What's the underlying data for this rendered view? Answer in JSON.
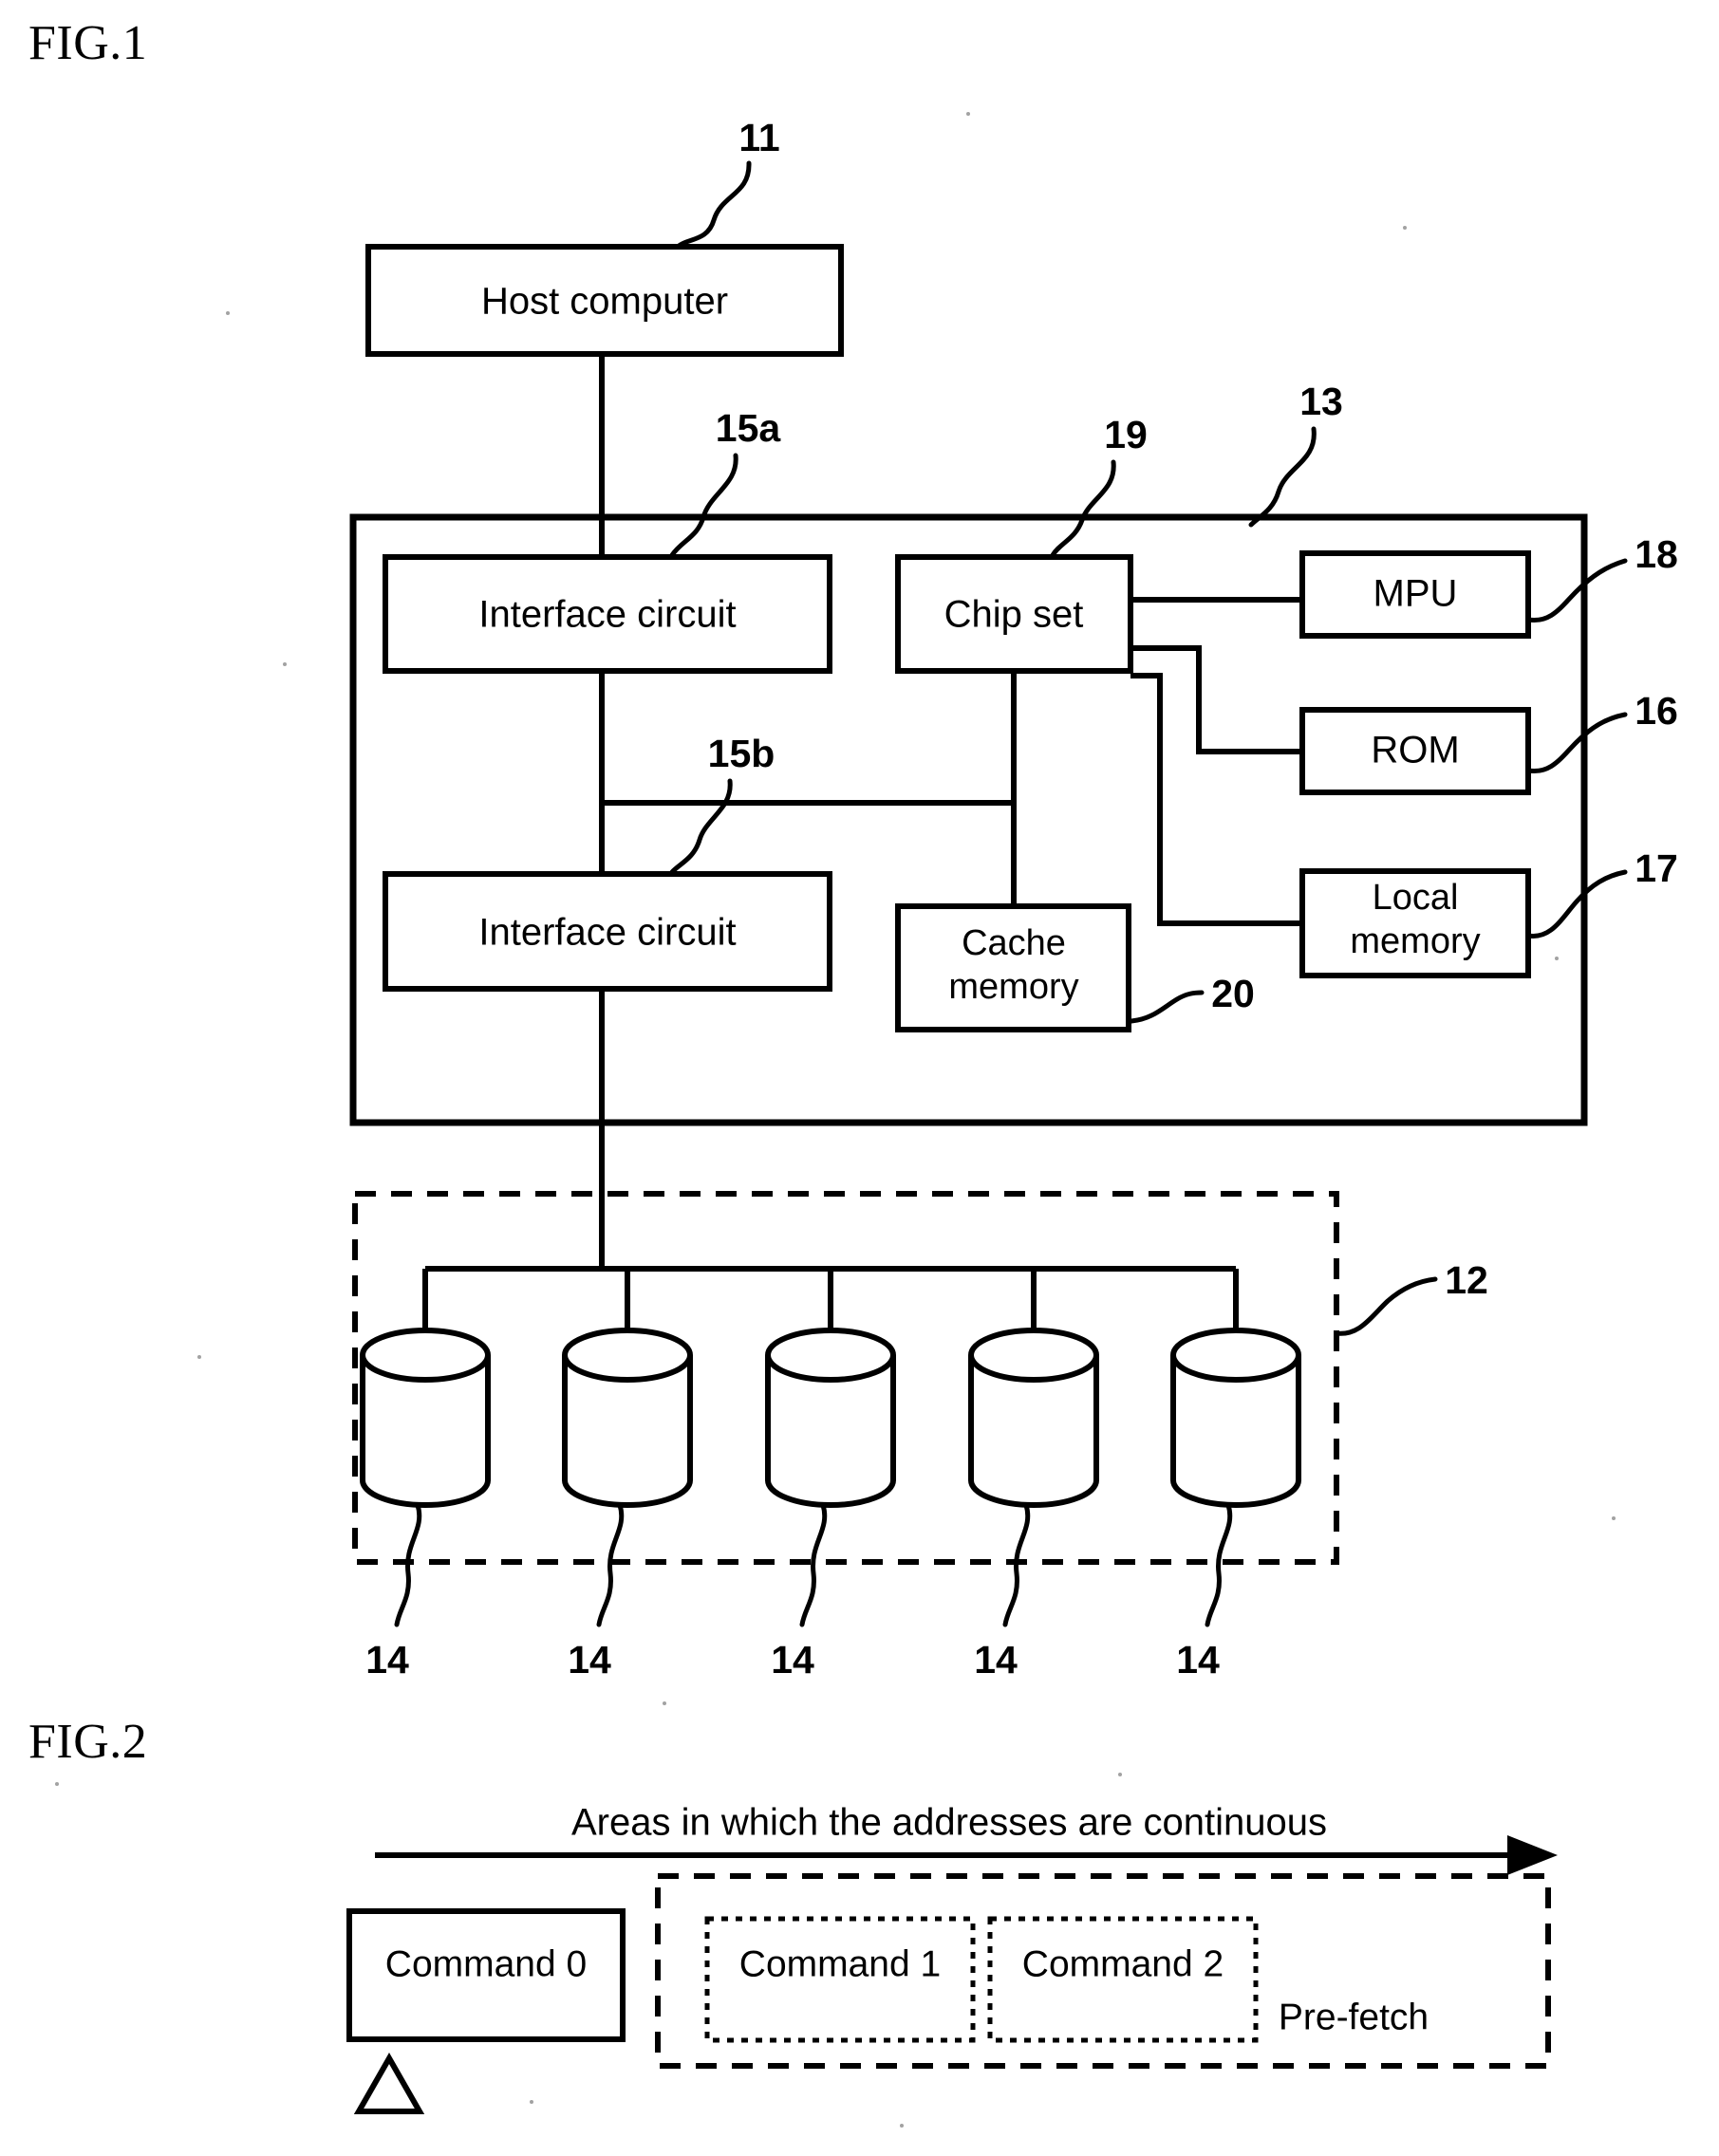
{
  "figures": [
    {
      "label": "FIG.1",
      "title_note": "Storage system block diagram",
      "blocks": {
        "host": "Host computer",
        "iface_a": "Interface circuit",
        "iface_b": "Interface circuit",
        "chipset": "Chip set",
        "mpu": "MPU",
        "rom": "ROM",
        "local_memory": "Local\nmemory",
        "local_memory_line1": "Local",
        "local_memory_line2": "memory",
        "cache_memory_line1": "Cache",
        "cache_memory_line2": "memory"
      },
      "reference_numerals": {
        "host": "11",
        "disk_array": "12",
        "controller": "13",
        "disk_1": "14",
        "disk_2": "14",
        "disk_3": "14",
        "disk_4": "14",
        "disk_5": "14",
        "iface_a": "15a",
        "iface_b": "15b",
        "rom": "16",
        "local_memory": "17",
        "mpu": "18",
        "chipset": "19",
        "cache_memory": "20"
      },
      "disk_count": 5
    },
    {
      "label": "FIG.2",
      "caption": "Areas in which the addresses are continuous",
      "commands": [
        {
          "label": "Command 0",
          "style": "solid"
        },
        {
          "label": "Command 1",
          "style": "dotted"
        },
        {
          "label": "Command 2",
          "style": "dotted"
        }
      ],
      "prefetch_label": "Pre-fetch",
      "marker": "triangle"
    }
  ],
  "colors": {
    "ink": "#000000",
    "paper": "#ffffff"
  }
}
